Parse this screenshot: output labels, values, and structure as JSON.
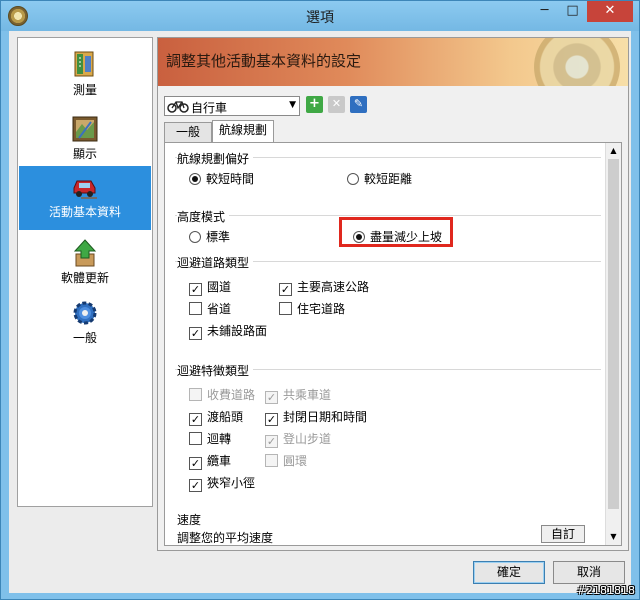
{
  "window": {
    "title": "選項",
    "controls": {
      "minimize": "─",
      "maximize": "□",
      "close": "✕"
    }
  },
  "sidebar": {
    "items": [
      {
        "label": "測量",
        "icon": "ruler-book-icon",
        "selected": false
      },
      {
        "label": "顯示",
        "icon": "map-display-icon",
        "selected": false
      },
      {
        "label": "活動基本資料",
        "icon": "car-wrench-icon",
        "selected": true
      },
      {
        "label": "軟體更新",
        "icon": "upgrade-arrow-icon",
        "selected": false
      },
      {
        "label": "一般",
        "icon": "gear-icon",
        "selected": false
      }
    ]
  },
  "panel": {
    "banner_title": "調整其他活動基本資料的設定",
    "profile": {
      "value": "自行車",
      "icon": "bicycle-icon"
    },
    "tabs": [
      {
        "label": "一般",
        "active": false
      },
      {
        "label": "航線規劃",
        "active": true
      }
    ],
    "routing_pref": {
      "title": "航線規劃偏好",
      "options": [
        {
          "label": "較短時間",
          "checked": true
        },
        {
          "label": "較短距離",
          "checked": false
        }
      ]
    },
    "elevation": {
      "title": "高度模式",
      "options": [
        {
          "label": "標準",
          "checked": false
        },
        {
          "label": "盡量減少上坡",
          "checked": true
        }
      ]
    },
    "avoid_roads": {
      "title": "迴避道路類型",
      "options": [
        {
          "label": "國道",
          "checked": true,
          "disabled": false
        },
        {
          "label": "主要高速公路",
          "checked": true,
          "disabled": false
        },
        {
          "label": "省道",
          "checked": false,
          "disabled": false
        },
        {
          "label": "住宅道路",
          "checked": false,
          "disabled": false
        },
        {
          "label": "未鋪設路面",
          "checked": true,
          "disabled": false
        }
      ]
    },
    "avoid_features": {
      "title": "迴避特徵類型",
      "options": [
        {
          "label": "收費道路",
          "checked": false,
          "disabled": true
        },
        {
          "label": "共乘車道",
          "checked": true,
          "disabled": true
        },
        {
          "label": "渡船頭",
          "checked": true,
          "disabled": false
        },
        {
          "label": "封閉日期和時間",
          "checked": true,
          "disabled": false
        },
        {
          "label": "迴轉",
          "checked": false,
          "disabled": false
        },
        {
          "label": "登山步道",
          "checked": true,
          "disabled": true
        },
        {
          "label": "纜車",
          "checked": true,
          "disabled": false
        },
        {
          "label": "圓環",
          "checked": false,
          "disabled": true
        },
        {
          "label": "狹窄小徑",
          "checked": true,
          "disabled": false
        }
      ]
    },
    "speed": {
      "title": "速度",
      "subtitle": "調整您的平均速度",
      "button": "自訂"
    }
  },
  "footer": {
    "ok": "確定",
    "cancel": "取消"
  },
  "watermark": "#2181818",
  "colors": {
    "selection": "#2c8fde",
    "highlight_border": "#e0281e",
    "titlebar": "#7fc0ea",
    "close_button": "#c7443a"
  }
}
